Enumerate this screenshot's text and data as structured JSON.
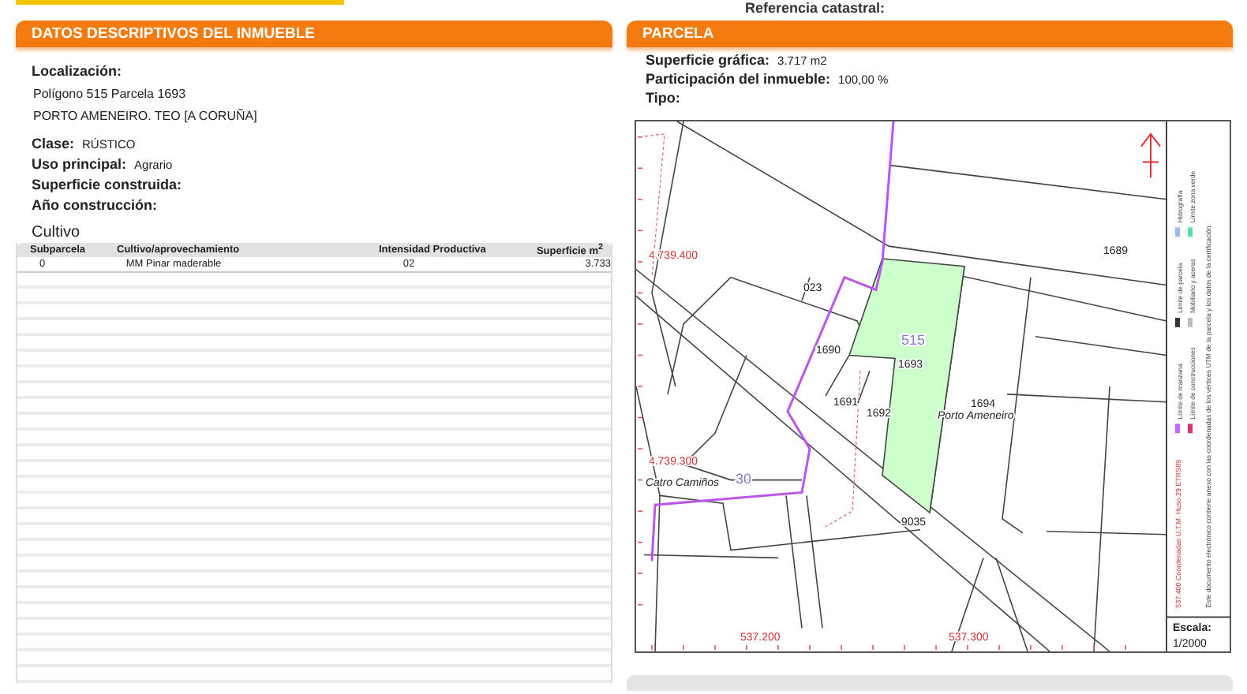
{
  "header": {
    "reference_label": "Referencia catastral:"
  },
  "descriptive": {
    "title": "DATOS DESCRIPTIVOS DEL **INMUEBLE**",
    "location": {
      "label": "Localización:",
      "lines": [
        "Polígono 515 Parcela 1693",
        "PORTO AMENEIRO. TEO [A CORUÑA]"
      ]
    },
    "fields": [
      {
        "label": "Clase:",
        "value": "RÚSTICO"
      },
      {
        "label": "Uso principal:",
        "value": "Agrario"
      },
      {
        "label": "Superficie construida:"
      },
      {
        "label": "Año construcción:"
      }
    ],
    "crops": {
      "title": "Cultivo",
      "columns": [
        "Subparcela",
        "Cultivo/aprovechamiento",
        "Intensidad Productiva",
        "Superficie m$^{2}$"
      ],
      "rows": [
        [
          "0",
          "MM Pinar maderable",
          "02",
          "3.733"
        ]
      ]
    }
  },
  "parcel": {
    "title": "PARCELA",
    "fields": [
      {
        "label": "Superficie gráfica:",
        "value": "3.717 m2"
      },
      {
        "label": "Participación del inmueble:",
        "value": "100,00 %"
      },
      {
        "label": "Tipo:"
      }
    ],
    "map": {
      "labels": [
        {
          "text": "1689",
          "kind": "parcel"
        },
        {
          "text": "023",
          "kind": "parcel"
        },
        {
          "text": "1690",
          "kind": "parcel"
        },
        {
          "text": "515",
          "kind": "polygon"
        },
        {
          "text": "1693",
          "kind": "parcel"
        },
        {
          "text": "1691",
          "kind": "parcel"
        },
        {
          "text": "1692",
          "kind": "parcel"
        },
        {
          "text": "1694",
          "kind": "parcel"
        },
        {
          "text": "Porto Ameneiro",
          "kind": "place"
        },
        {
          "text": "9035",
          "kind": "parcel"
        },
        {
          "text": "Catro Camiños",
          "kind": "place"
        },
        {
          "text": "30",
          "kind": "polygon"
        },
        {
          "text": "4.739.400",
          "kind": "coord"
        },
        {
          "text": "4.739.300",
          "kind": "coord"
        },
        {
          "text": "537.200",
          "kind": "coord"
        },
        {
          "text": "537.300",
          "kind": "coord"
        }
      ],
      "coord_note": "537.400 Coordenadas U.T.M. Huso 29 ETRS89",
      "legend": [
        {
          "text": "Límite de manzana",
          "color": "#cc66ff"
        },
        {
          "text": "Límite de parcela",
          "color": "#333333"
        },
        {
          "text": "Hidrografía",
          "color": "#99bbee"
        },
        {
          "text": "Límite de construcciones",
          "color": "#dd3366"
        },
        {
          "text": "Mobiliario y aceras",
          "color": "#bbbbbb"
        },
        {
          "text": "Límite zona verde",
          "color": "#55ddbb"
        }
      ],
      "disclaimer": "Este documento electrónico contiene anexo con las coordenadas de los vértices UTM de la parcela y los datos de la certificación.",
      "scale_label": "Escala:",
      "scale": "1/2000"
    }
  }
}
